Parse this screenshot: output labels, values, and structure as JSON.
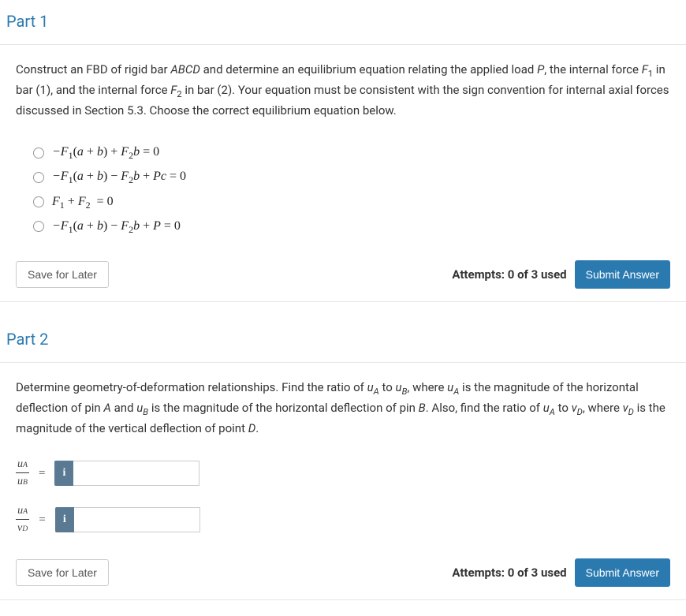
{
  "chart_data": null,
  "part1": {
    "title": "Part 1",
    "question_prefix": "Construct an FBD of rigid bar ",
    "question_abcd": "ABCD",
    "question_mid1": " and determine an equilibrium equation relating the applied load ",
    "question_P": "P",
    "question_mid2": ", the internal force ",
    "question_F1": "F",
    "question_F1_sub": "1",
    "question_mid3": " in bar (1), and the internal force ",
    "question_F2": "F",
    "question_F2_sub": "2",
    "question_mid4": " in bar (2).  Your equation must be consistent with the sign convention for internal axial forces discussed in Section 5.3.  Choose the correct equilibrium equation below.",
    "options": [
      "−F₁(a + b) + F₂b = 0",
      "−F₁(a + b) − F₂b + Pc = 0",
      "F₁ + F₂  = 0",
      "−F₁(a + b) − F₂b + P = 0"
    ],
    "save_label": "Save for Later",
    "attempts": "Attempts: 0 of 3 used",
    "submit_label": "Submit Answer"
  },
  "part2": {
    "title": "Part 2",
    "q_pre": "Determine geometry-of-deformation relationships.  Find the ratio of ",
    "uA": "u",
    "uA_sub": "A",
    "q_to1": " to ",
    "uB": "u",
    "uB_sub": "B",
    "q_where1": ", where ",
    "q_mid1": " is the magnitude of the horizontal deflection of pin ",
    "pinA": "A",
    "q_and": " and ",
    "q_mid2": " is the magnitude of the horizontal deflection of pin ",
    "pinB": "B",
    "q_also": ".  Also, find the ratio of ",
    "q_to2": " to ",
    "vD": "v",
    "vD_sub": "D",
    "q_where2": ", where ",
    "q_mid3": " is the magnitude of the vertical deflection of point ",
    "pinD": "D",
    "q_end": ".",
    "ratios": [
      {
        "num": "u",
        "num_sub": "A",
        "den": "u",
        "den_sub": "B"
      },
      {
        "num": "u",
        "num_sub": "A",
        "den": "v",
        "den_sub": "D"
      }
    ],
    "info_icon": "i",
    "equals": "=",
    "save_label": "Save for Later",
    "attempts": "Attempts: 0 of 3 used",
    "submit_label": "Submit Answer"
  }
}
